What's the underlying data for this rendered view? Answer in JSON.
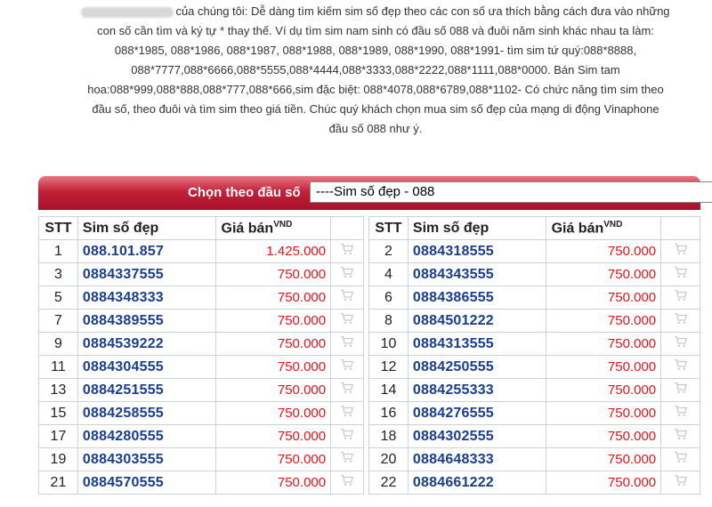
{
  "intro": {
    "text_lines": [
      "của chúng tôi: Dễ dàng tìm kiếm sim số đẹp theo các con số ưa thích bằng cách đưa vào những",
      "con số cần tìm và ký tự * thay thế. Ví dụ tìm sim nam sinh có đầu số 088 và đuôi năm sinh khác nhau ta làm:",
      "088*1985, 088*1986, 088*1987, 088*1988, 088*1989, 088*1990, 088*1991- tìm sim tứ quý:088*8888,",
      "088*7777,088*6666,088*5555,088*4444,088*3333,088*2222,088*1111,088*0000. Bán Sim tam",
      "hoa:088*999,088*888,088*777,088*666,sim đặc biệt: 088*4078,088*6789,088*1102- Có chức năng tìm sim theo",
      "đầu số, theo đuôi và tìm sim theo giá tiền. Chúc quý khách chọn mua sim số đẹp của mạng di động Vinaphone",
      "đầu số 088 như ý."
    ]
  },
  "filter": {
    "label": "Chọn theo đầu số",
    "selected": "----Sim số đẹp - 088",
    "arrow": "▼"
  },
  "table": {
    "headers": {
      "stt": "STT",
      "sim": "Sim số đẹp",
      "price": "Giá bán",
      "unit": "VND"
    },
    "left": [
      {
        "stt": "1",
        "sim": "088.101.857",
        "price": "1.425.000"
      },
      {
        "stt": "3",
        "sim": "0884337555",
        "price": "750.000"
      },
      {
        "stt": "5",
        "sim": "0884348333",
        "price": "750.000"
      },
      {
        "stt": "7",
        "sim": "0884389555",
        "price": "750.000"
      },
      {
        "stt": "9",
        "sim": "0884539222",
        "price": "750.000"
      },
      {
        "stt": "11",
        "sim": "0884304555",
        "price": "750.000"
      },
      {
        "stt": "13",
        "sim": "0884251555",
        "price": "750.000"
      },
      {
        "stt": "15",
        "sim": "0884258555",
        "price": "750.000"
      },
      {
        "stt": "17",
        "sim": "0884280555",
        "price": "750.000"
      },
      {
        "stt": "19",
        "sim": "0884303555",
        "price": "750.000"
      },
      {
        "stt": "21",
        "sim": "0884570555",
        "price": "750.000"
      }
    ],
    "right": [
      {
        "stt": "2",
        "sim": "0884318555",
        "price": "750.000"
      },
      {
        "stt": "4",
        "sim": "0884343555",
        "price": "750.000"
      },
      {
        "stt": "6",
        "sim": "0884386555",
        "price": "750.000"
      },
      {
        "stt": "8",
        "sim": "0884501222",
        "price": "750.000"
      },
      {
        "stt": "10",
        "sim": "0884313555",
        "price": "750.000"
      },
      {
        "stt": "12",
        "sim": "0884250555",
        "price": "750.000"
      },
      {
        "stt": "14",
        "sim": "0884255333",
        "price": "750.000"
      },
      {
        "stt": "16",
        "sim": "0884276555",
        "price": "750.000"
      },
      {
        "stt": "18",
        "sim": "0884302555",
        "price": "750.000"
      },
      {
        "stt": "20",
        "sim": "0884648333",
        "price": "750.000"
      },
      {
        "stt": "22",
        "sim": "0884661222",
        "price": "750.000"
      }
    ]
  },
  "icons": {
    "cart": "shopping-cart-icon"
  },
  "colors": {
    "accent": "#c2223a",
    "sim_number": "#1a3e8c",
    "price": "#e0151c",
    "border": "#c8d2e3"
  }
}
